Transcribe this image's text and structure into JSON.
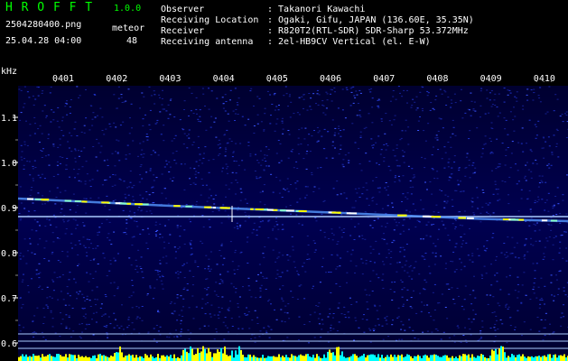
{
  "header": {
    "app_title": "H R O F F T",
    "version": "1.0.0",
    "filename": "2504280400.png",
    "datetime": "25.04.28 04:00",
    "meteor_label": "meteor",
    "meteor_count": "48",
    "info": {
      "observer_label": "Observer",
      "observer_value": ": Takanori Kawachi",
      "location_label": "Receiving Location",
      "location_value": ": Ogaki, Gifu, JAPAN (136.60E, 35.35N)",
      "receiver_label": "Receiver",
      "receiver_value": ": R820T2(RTL-SDR) SDR-Sharp 53.372MHz",
      "antenna_label": "Receiving antenna",
      "antenna_value": ": 2el-HB9CV Vertical (el. E-W)"
    }
  },
  "chart_data": {
    "type": "heatmap",
    "ylabel": "kHz",
    "y_ticks": [
      "1.1",
      "1.0",
      "0.9",
      "0.8",
      "0.7",
      "0.6"
    ],
    "x_ticks": [
      "0401",
      "0402",
      "0403",
      "0404",
      "0405",
      "0406",
      "0407",
      "0408",
      "0409",
      "0410"
    ],
    "ylim": [
      0.58,
      1.17
    ],
    "colors": {
      "background": "#000044",
      "noise": "#2233cc",
      "signal": "#ffff00",
      "carrier": "#aaccff",
      "baseline": "#00ffff"
    },
    "traces": [
      {
        "name": "",
        "x": [
          "0401",
          "0403",
          "0405",
          "0407",
          "0409",
          "0410"
        ],
        "y": [
          0.92,
          0.905,
          0.895,
          0.885,
          0.875,
          0.87
        ]
      },
      {
        "name": "",
        "x": [
          "0401",
          "0410"
        ],
        "y": [
          0.88,
          0.88
        ]
      }
    ]
  }
}
